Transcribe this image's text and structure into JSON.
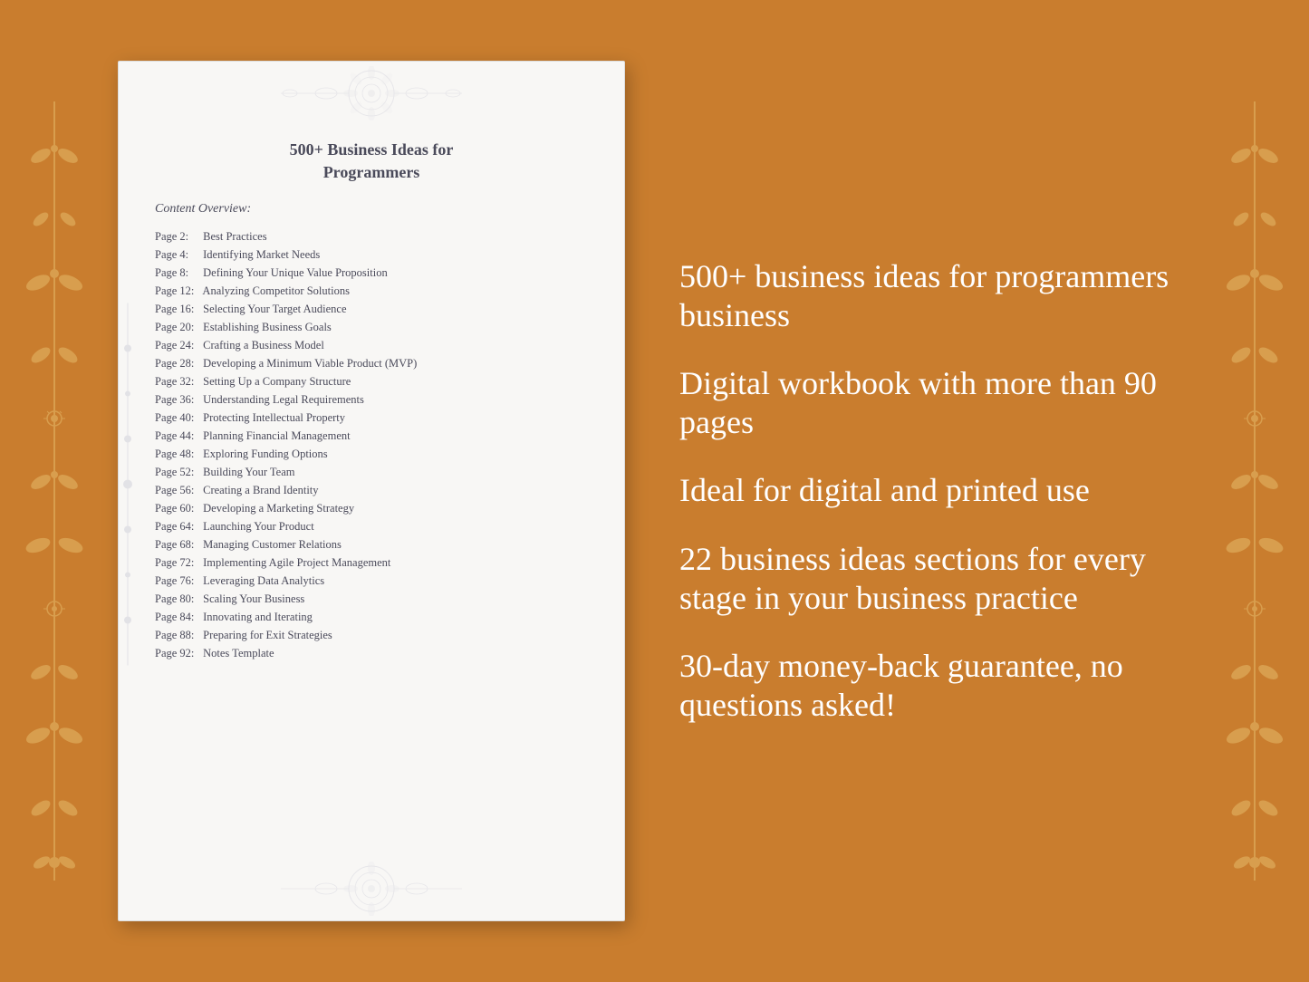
{
  "background_color": "#C97D2E",
  "document": {
    "title_line1": "500+ Business Ideas for",
    "title_line2": "Programmers",
    "content_label": "Content Overview:",
    "toc_items": [
      {
        "page": "Page  2:",
        "title": "Best Practices"
      },
      {
        "page": "Page  4:",
        "title": "Identifying Market Needs"
      },
      {
        "page": "Page  8:",
        "title": "Defining Your Unique Value Proposition"
      },
      {
        "page": "Page 12:",
        "title": "Analyzing Competitor Solutions"
      },
      {
        "page": "Page 16:",
        "title": "Selecting Your Target Audience"
      },
      {
        "page": "Page 20:",
        "title": "Establishing Business Goals"
      },
      {
        "page": "Page 24:",
        "title": "Crafting a Business Model"
      },
      {
        "page": "Page 28:",
        "title": "Developing a Minimum Viable Product (MVP)"
      },
      {
        "page": "Page 32:",
        "title": "Setting Up a Company Structure"
      },
      {
        "page": "Page 36:",
        "title": "Understanding Legal Requirements"
      },
      {
        "page": "Page 40:",
        "title": "Protecting Intellectual Property"
      },
      {
        "page": "Page 44:",
        "title": "Planning Financial Management"
      },
      {
        "page": "Page 48:",
        "title": "Exploring Funding Options"
      },
      {
        "page": "Page 52:",
        "title": "Building Your Team"
      },
      {
        "page": "Page 56:",
        "title": "Creating a Brand Identity"
      },
      {
        "page": "Page 60:",
        "title": "Developing a Marketing Strategy"
      },
      {
        "page": "Page 64:",
        "title": "Launching Your Product"
      },
      {
        "page": "Page 68:",
        "title": "Managing Customer Relations"
      },
      {
        "page": "Page 72:",
        "title": "Implementing Agile Project Management"
      },
      {
        "page": "Page 76:",
        "title": "Leveraging Data Analytics"
      },
      {
        "page": "Page 80:",
        "title": "Scaling Your Business"
      },
      {
        "page": "Page 84:",
        "title": "Innovating and Iterating"
      },
      {
        "page": "Page 88:",
        "title": "Preparing for Exit Strategies"
      },
      {
        "page": "Page 92:",
        "title": "Notes Template"
      }
    ]
  },
  "info_points": [
    "500+ business ideas for programmers business",
    "Digital workbook with more than 90 pages",
    "Ideal for digital and printed use",
    "22 business ideas sections for every stage in your business practice",
    "30-day money-back guarantee, no questions asked!"
  ]
}
